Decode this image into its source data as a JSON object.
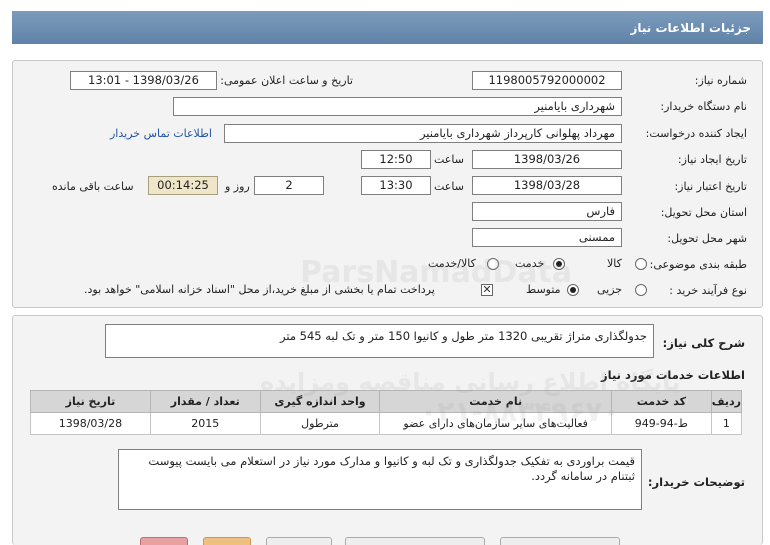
{
  "header": {
    "title": "جزئیات اطلاعات نیاز"
  },
  "form": {
    "need_number_label": "شماره نیاز:",
    "need_number": "1198005792000002",
    "announce_label": "تاریخ و ساعت اعلان عمومی:",
    "announce_value": "1398/03/26 - 13:01",
    "buyer_label": "نام دستگاه خریدار:",
    "buyer": "شهرداری بایامنیر",
    "requester_label": "ایجاد کننده درخواست:",
    "requester": "مهرداد پهلوانی کارپرداز شهرداری بایامنیر",
    "contact_link": "اطلاعات تماس خریدار",
    "created_label": "تاریخ ایجاد نیاز:",
    "created_date": "1398/03/26",
    "hour_label": "ساعت",
    "created_time": "12:50",
    "valid_label": "تاریخ اعتبار نیاز:",
    "valid_date": "1398/03/28",
    "valid_time": "13:30",
    "days_value": "2",
    "days_label": "روز و",
    "remaining": "00:14:25",
    "remaining_label": "ساعت باقی مانده",
    "province_label": "استان محل تحویل:",
    "province": "فارس",
    "city_label": "شهر محل تحویل:",
    "city": "ممسنی",
    "category_label": "طبقه بندی موضوعی:",
    "category_options": [
      "کالا",
      "خدمت",
      "کالا/خدمت"
    ],
    "process_label": "نوع فرآیند خرید :",
    "process_options": [
      "جزیی",
      "متوسط"
    ],
    "payment_note": "پرداخت تمام یا بخشی از مبلغ خرید،از محل \"اسناد خزانه اسلامی\" خواهد بود."
  },
  "description": {
    "label": "شرح کلی نیاز:",
    "text": "جدولگذاری متراژ تقریبی 1320 متر طول و کانیوا 150 متر و تک لبه 545 متر"
  },
  "services": {
    "title": "اطلاعات خدمات مورد نیاز",
    "columns": [
      "ردیف",
      "کد خدمت",
      "نام خدمت",
      "واحد اندازه گیری",
      "تعداد / مقدار",
      "تاریخ نیاز"
    ],
    "rows": [
      [
        "1",
        "ط-94-949",
        "فعالیت‌های سایر سازمان‌های دارای عضو",
        "مترطول",
        "2015",
        "1398/03/28"
      ]
    ]
  },
  "buyer_notes": {
    "label": "توضیحات خریدار:",
    "text": "قیمت براوردی به تفکیک جدولگذاری و تک لبه و کانیوا و مدارک مورد نیاز در استعلام می بایست پیوست ثبتنام در سامانه گردد."
  },
  "watermark": {
    "line1": "ParsNamadData",
    "line2": "پایگاه اطلاع رسانی مناقصه ومزایده",
    "line3": "۰۲۱-۸۸۳۴۹۶۷۰"
  },
  "colors": {
    "header": "#6a8bb0",
    "timer_bg": "#efe6c9",
    "link": "#2255aa"
  }
}
